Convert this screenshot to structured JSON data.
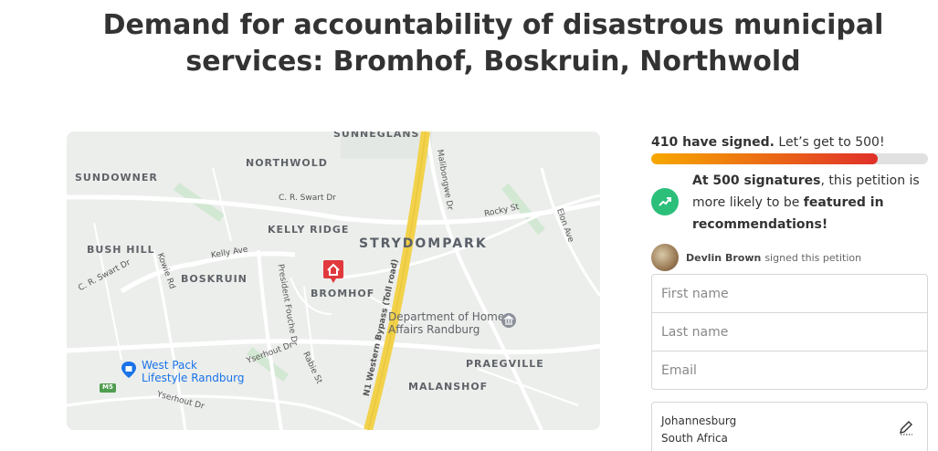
{
  "petition": {
    "title": "Demand for accountability of disastrous municipal services: Bromhof, Boskruin, Northwold"
  },
  "map": {
    "areas": {
      "sunneglans": "SUNNEGLANS",
      "northwold": "NORTHWOLD",
      "sundowner": "SUNDOWNER",
      "kelly_ridge": "KELLY RIDGE",
      "strydompark": "STRYDOMPARK",
      "bush_hill": "BUSH HILL",
      "boskruin": "BOSKRUIN",
      "bromhof": "BROMHOF",
      "praegville": "PRAEGVILLE",
      "malanshof": "MALANSHOF"
    },
    "roads": {
      "cr_swart_1": "C. R. Swart Dr",
      "cr_swart_2": "C. R. Swart Dr",
      "kelly_ave": "Kelly Ave",
      "kowie_rd": "Kowie Rd",
      "president_fouche": "President Fouche Dr",
      "yserhout_1": "Yserhout Dr",
      "yserhout_2": "Yserhout Dr",
      "rabie_st": "Rabie St",
      "mallbongwe": "Malibongwe Dr",
      "rocky_st": "Rocky St",
      "elon_ave": "Elon Ave",
      "n1": "N1 Western Bypass (Toll road)",
      "m5": "M5"
    },
    "pois": {
      "home_affairs_line1": "Department of Home",
      "home_affairs_line2": "Affairs Randburg",
      "west_pack_line1": "West Pack",
      "west_pack_line2": "Lifestyle Randburg"
    },
    "icons": {
      "pin": "house-pin-icon",
      "museum": "museum-icon",
      "shopping": "shopping-bag-icon"
    },
    "colors": {
      "pin": "#e0393e",
      "poi_blue": "#1a73e8",
      "highway": "#f2d24b"
    }
  },
  "progress": {
    "signed_text": "410 have signed.",
    "goal_text": "Let’s get to 500!",
    "fraction": 0.82
  },
  "promo": {
    "icon": "trending-up-icon",
    "bold_1": "At 500 signatures",
    "text_1": ", this petition is more likely to be ",
    "bold_2": "featured in recommendations!"
  },
  "recent_signer": {
    "name": "Devlin Brown",
    "action": "signed this petition"
  },
  "form": {
    "first_name_placeholder": "First name",
    "last_name_placeholder": "Last name",
    "email_placeholder": "Email",
    "city": "Johannesburg",
    "country": "South Africa",
    "edit_icon": "edit-pencil-icon"
  }
}
